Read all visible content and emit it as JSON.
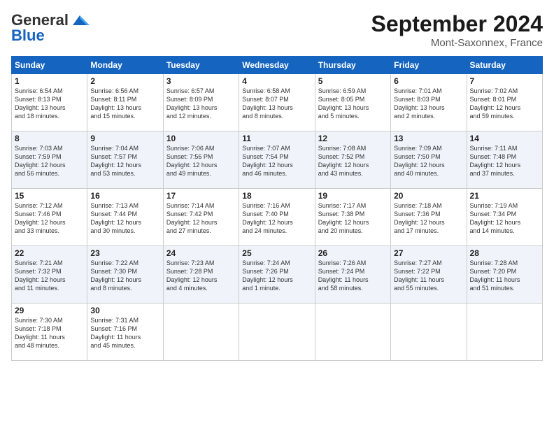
{
  "header": {
    "logo_general": "General",
    "logo_blue": "Blue",
    "month_title": "September 2024",
    "location": "Mont-Saxonnex, France"
  },
  "days_of_week": [
    "Sunday",
    "Monday",
    "Tuesday",
    "Wednesday",
    "Thursday",
    "Friday",
    "Saturday"
  ],
  "weeks": [
    [
      {
        "day": "1",
        "info": "Sunrise: 6:54 AM\nSunset: 8:13 PM\nDaylight: 13 hours\nand 18 minutes."
      },
      {
        "day": "2",
        "info": "Sunrise: 6:56 AM\nSunset: 8:11 PM\nDaylight: 13 hours\nand 15 minutes."
      },
      {
        "day": "3",
        "info": "Sunrise: 6:57 AM\nSunset: 8:09 PM\nDaylight: 13 hours\nand 12 minutes."
      },
      {
        "day": "4",
        "info": "Sunrise: 6:58 AM\nSunset: 8:07 PM\nDaylight: 13 hours\nand 8 minutes."
      },
      {
        "day": "5",
        "info": "Sunrise: 6:59 AM\nSunset: 8:05 PM\nDaylight: 13 hours\nand 5 minutes."
      },
      {
        "day": "6",
        "info": "Sunrise: 7:01 AM\nSunset: 8:03 PM\nDaylight: 13 hours\nand 2 minutes."
      },
      {
        "day": "7",
        "info": "Sunrise: 7:02 AM\nSunset: 8:01 PM\nDaylight: 12 hours\nand 59 minutes."
      }
    ],
    [
      {
        "day": "8",
        "info": "Sunrise: 7:03 AM\nSunset: 7:59 PM\nDaylight: 12 hours\nand 56 minutes."
      },
      {
        "day": "9",
        "info": "Sunrise: 7:04 AM\nSunset: 7:57 PM\nDaylight: 12 hours\nand 53 minutes."
      },
      {
        "day": "10",
        "info": "Sunrise: 7:06 AM\nSunset: 7:56 PM\nDaylight: 12 hours\nand 49 minutes."
      },
      {
        "day": "11",
        "info": "Sunrise: 7:07 AM\nSunset: 7:54 PM\nDaylight: 12 hours\nand 46 minutes."
      },
      {
        "day": "12",
        "info": "Sunrise: 7:08 AM\nSunset: 7:52 PM\nDaylight: 12 hours\nand 43 minutes."
      },
      {
        "day": "13",
        "info": "Sunrise: 7:09 AM\nSunset: 7:50 PM\nDaylight: 12 hours\nand 40 minutes."
      },
      {
        "day": "14",
        "info": "Sunrise: 7:11 AM\nSunset: 7:48 PM\nDaylight: 12 hours\nand 37 minutes."
      }
    ],
    [
      {
        "day": "15",
        "info": "Sunrise: 7:12 AM\nSunset: 7:46 PM\nDaylight: 12 hours\nand 33 minutes."
      },
      {
        "day": "16",
        "info": "Sunrise: 7:13 AM\nSunset: 7:44 PM\nDaylight: 12 hours\nand 30 minutes."
      },
      {
        "day": "17",
        "info": "Sunrise: 7:14 AM\nSunset: 7:42 PM\nDaylight: 12 hours\nand 27 minutes."
      },
      {
        "day": "18",
        "info": "Sunrise: 7:16 AM\nSunset: 7:40 PM\nDaylight: 12 hours\nand 24 minutes."
      },
      {
        "day": "19",
        "info": "Sunrise: 7:17 AM\nSunset: 7:38 PM\nDaylight: 12 hours\nand 20 minutes."
      },
      {
        "day": "20",
        "info": "Sunrise: 7:18 AM\nSunset: 7:36 PM\nDaylight: 12 hours\nand 17 minutes."
      },
      {
        "day": "21",
        "info": "Sunrise: 7:19 AM\nSunset: 7:34 PM\nDaylight: 12 hours\nand 14 minutes."
      }
    ],
    [
      {
        "day": "22",
        "info": "Sunrise: 7:21 AM\nSunset: 7:32 PM\nDaylight: 12 hours\nand 11 minutes."
      },
      {
        "day": "23",
        "info": "Sunrise: 7:22 AM\nSunset: 7:30 PM\nDaylight: 12 hours\nand 8 minutes."
      },
      {
        "day": "24",
        "info": "Sunrise: 7:23 AM\nSunset: 7:28 PM\nDaylight: 12 hours\nand 4 minutes."
      },
      {
        "day": "25",
        "info": "Sunrise: 7:24 AM\nSunset: 7:26 PM\nDaylight: 12 hours\nand 1 minute."
      },
      {
        "day": "26",
        "info": "Sunrise: 7:26 AM\nSunset: 7:24 PM\nDaylight: 11 hours\nand 58 minutes."
      },
      {
        "day": "27",
        "info": "Sunrise: 7:27 AM\nSunset: 7:22 PM\nDaylight: 11 hours\nand 55 minutes."
      },
      {
        "day": "28",
        "info": "Sunrise: 7:28 AM\nSunset: 7:20 PM\nDaylight: 11 hours\nand 51 minutes."
      }
    ],
    [
      {
        "day": "29",
        "info": "Sunrise: 7:30 AM\nSunset: 7:18 PM\nDaylight: 11 hours\nand 48 minutes."
      },
      {
        "day": "30",
        "info": "Sunrise: 7:31 AM\nSunset: 7:16 PM\nDaylight: 11 hours\nand 45 minutes."
      },
      {
        "day": "",
        "info": ""
      },
      {
        "day": "",
        "info": ""
      },
      {
        "day": "",
        "info": ""
      },
      {
        "day": "",
        "info": ""
      },
      {
        "day": "",
        "info": ""
      }
    ]
  ]
}
